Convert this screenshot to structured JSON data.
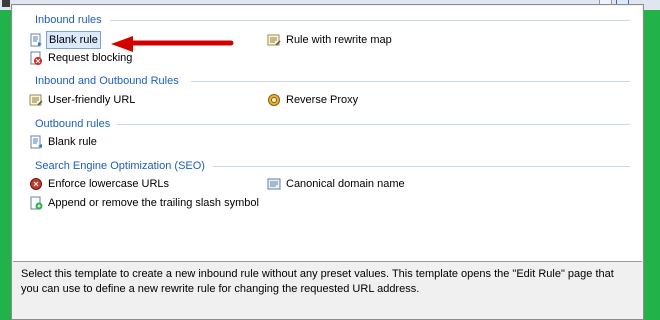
{
  "groups": {
    "inbound": "Inbound rules",
    "inbound_outbound": "Inbound and Outbound Rules",
    "outbound": "Outbound rules",
    "seo": "Search Engine Optimization (SEO)"
  },
  "items": {
    "blank_rule_inbound": "Blank rule",
    "rule_rewrite_map": "Rule with rewrite map",
    "request_blocking": "Request blocking",
    "user_friendly_url": "User-friendly URL",
    "reverse_proxy": "Reverse Proxy",
    "blank_rule_outbound": "Blank rule",
    "enforce_lowercase": "Enforce lowercase URLs",
    "canonical_domain": "Canonical domain name",
    "trailing_slash": "Append or remove the trailing slash symbol"
  },
  "description": {
    "line1": "Select this template to create a new inbound rule without any preset values. This template opens the \"Edit Rule\" page that",
    "line2": "you can use to define a new rewrite rule for changing the requested URL address."
  },
  "colors": {
    "group_header": "#1c5dbb",
    "selection_bg": "#dbeafc",
    "annotation_arrow": "#d40000",
    "window_border": "#21b24a"
  },
  "selected_item": "Blank rule"
}
